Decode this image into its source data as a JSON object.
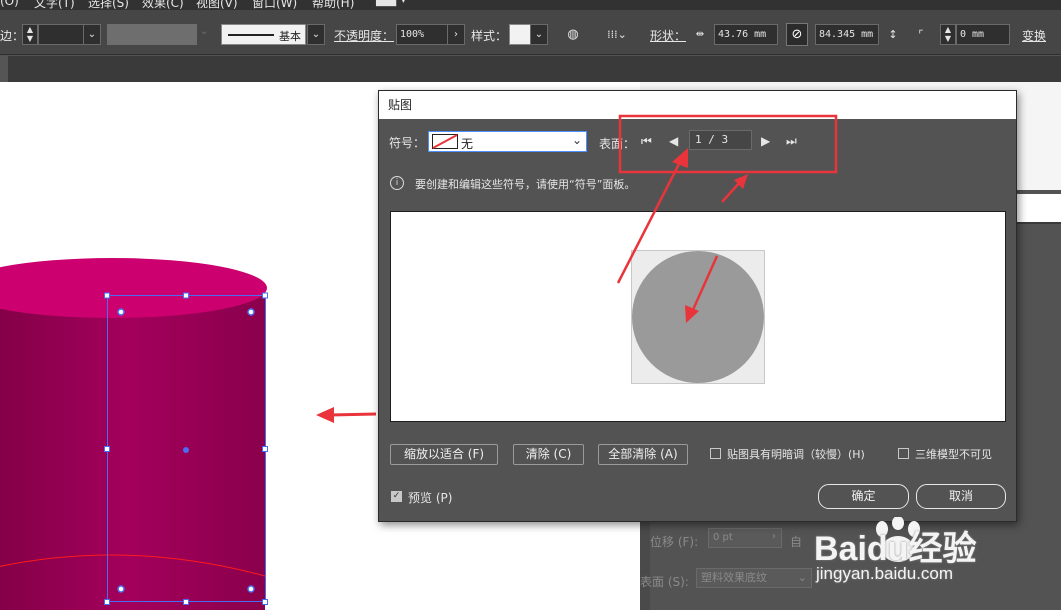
{
  "menu": {
    "items": [
      "(O)",
      "文字(T)",
      "选择(S)",
      "效果(C)",
      "视图(V)",
      "窗口(W)",
      "帮助(H)"
    ]
  },
  "control_bar": {
    "stroke_label": "边：",
    "brush_label": "基本",
    "opacity_label": "不透明度：",
    "opacity_value": "100%",
    "style_label": "样式：",
    "shape_label": "形状：",
    "width_value": "43.76 mm",
    "height_value": "84.345 mm",
    "corner_value": "0 mm",
    "transform_label": "变换"
  },
  "dialog": {
    "title": "贴图",
    "symbol_label": "符号：",
    "symbol_value": "无",
    "surface_label": "表面：",
    "surface_page": "1 / 3",
    "info_text": "要创建和编辑这些符号，请使用“符号”面板。",
    "buttons": {
      "fit": "缩放以适合 (F)",
      "clear": "清除 (C)",
      "clear_all": "全部清除 (A)",
      "ok": "确定",
      "cancel": "取消"
    },
    "shade_artwork_label": "贴图具有明暗调（较慢）(H)",
    "shade_artwork_checked": false,
    "invisible_geometry_label": "三维模型不可见",
    "invisible_geometry_checked": false,
    "preview_label": "预览 (P)",
    "preview_checked": true
  },
  "background_panel": {
    "offset_label": "位移 (F):",
    "offset_value": "0 pt",
    "offset_suffix": "自",
    "surface_label": "表面 (S):",
    "surface_value": "塑料效果底纹"
  },
  "watermark": {
    "brand": "Baidu经验",
    "url": "jingyan.baidu.com"
  },
  "colors": {
    "annotation_red": "#e8343a",
    "cylinder_magenta": "#a0005a",
    "selection_blue": "#4a6cf0",
    "dialog_bg": "#535353"
  }
}
